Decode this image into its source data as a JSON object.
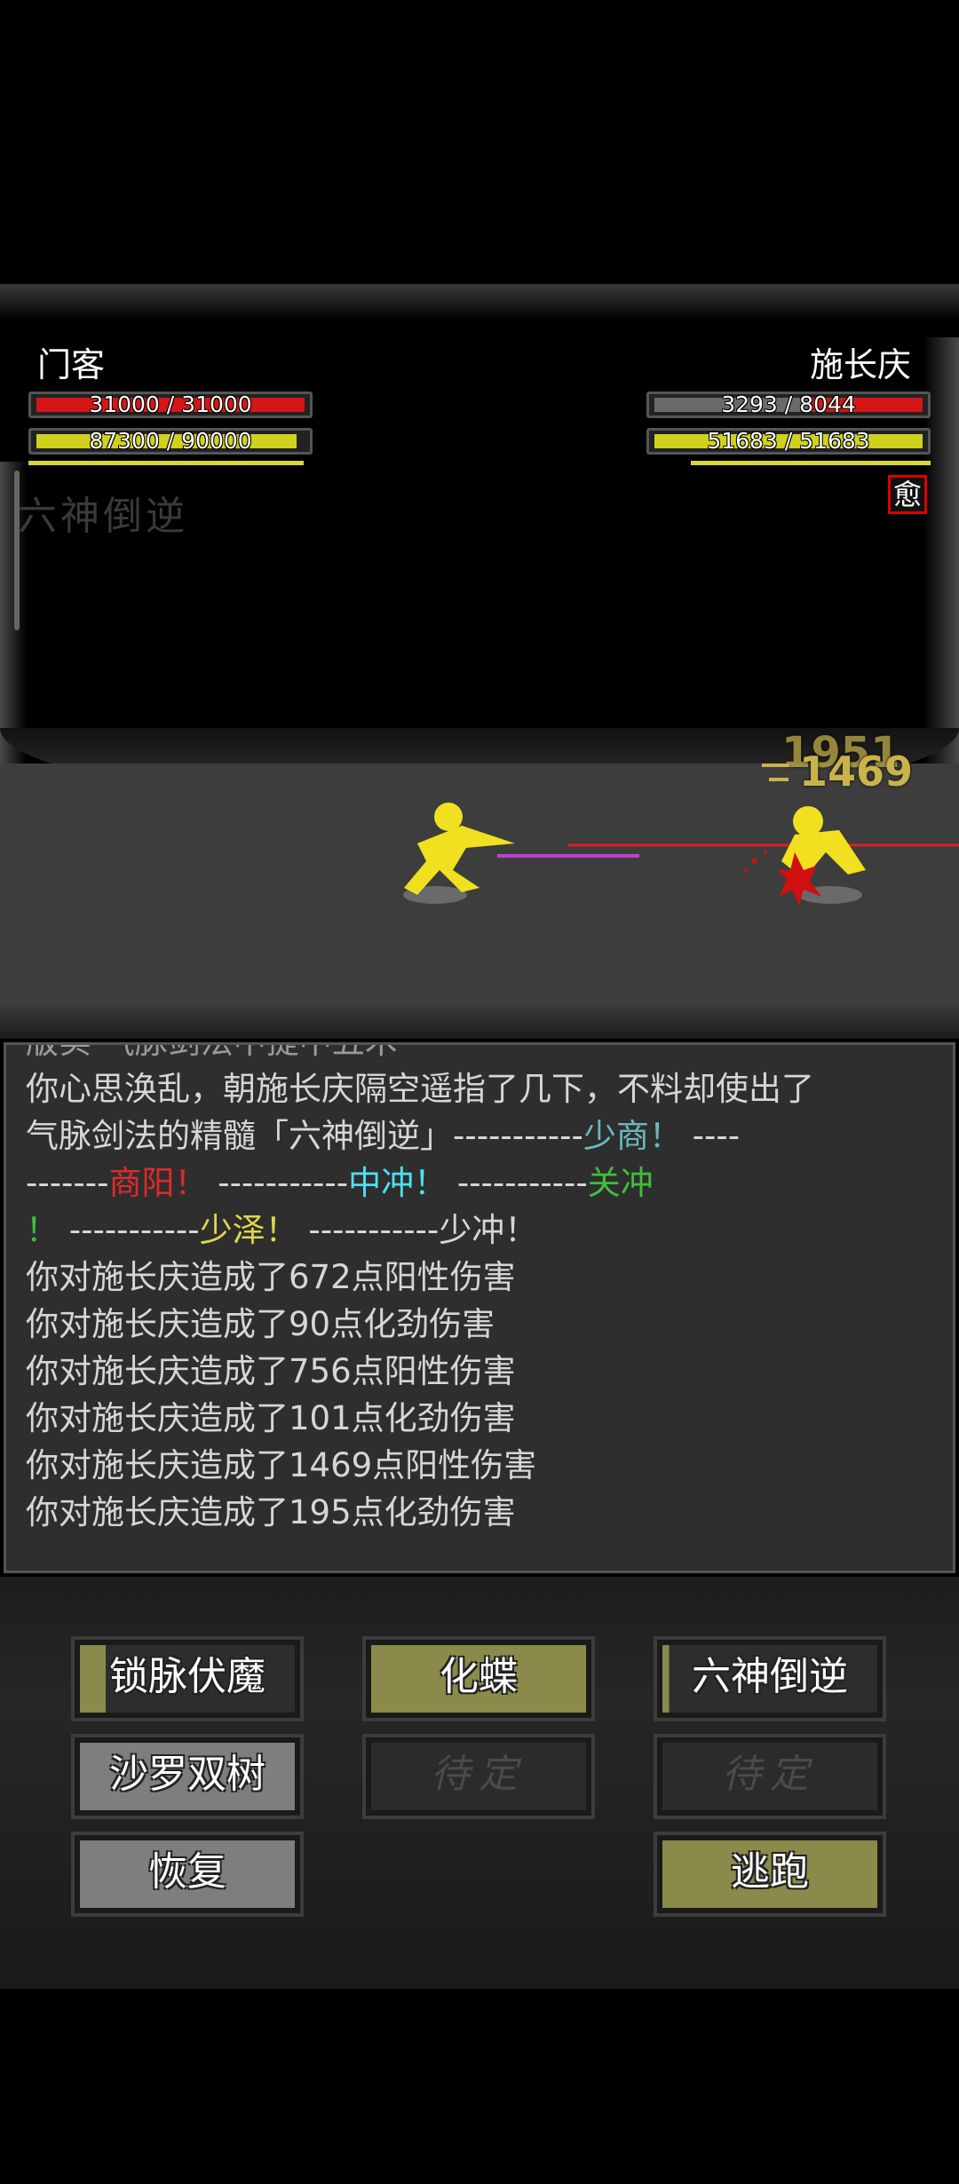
{
  "player": {
    "name": "门客",
    "hp_text": "31000 / 31000",
    "hp_fraction": 1.0,
    "mp_text": "87300 / 90000",
    "mp_fraction": 0.97
  },
  "enemy": {
    "name": "施长庆",
    "hp_text": "3293 / 8044",
    "hp_fraction": 0.41,
    "mp_text": "51683 / 51683",
    "mp_fraction": 1.0,
    "status_badge": "愈"
  },
  "battle": {
    "skill_name_faded": "六神倒逆",
    "damage_numbers": [
      "1951",
      "1469"
    ]
  },
  "log": {
    "cut_line": "版实  气脉剑法中提中五术",
    "line1": "你心思涣乱，朝施长庆隔空遥指了几下，不料却使出了",
    "line2_prefix": "气脉剑法的精髓「六神倒逆」-----------",
    "line2_a": "少商！",
    "line2_dash": " ----",
    "line3_dash1": "-------",
    "line3_b": "商阳！",
    "line3_dash2": " -----------",
    "line3_c": "中冲！",
    "line3_dash3": " -----------",
    "line3_d": "关冲",
    "line4_d_end": "！",
    "line4_dash1": " -----------",
    "line4_e": "少泽！",
    "line4_dash2": " -----------",
    "line4_f": "少冲！",
    "entries": [
      "你对施长庆造成了672点阳性伤害",
      "你对施长庆造成了90点化劲伤害",
      "你对施长庆造成了756点阳性伤害",
      "你对施长庆造成了101点化劲伤害",
      "你对施长庆造成了1469点阳性伤害",
      "你对施长庆造成了195点化劲伤害"
    ]
  },
  "skills": {
    "b1": "锁脉伏魔",
    "b1_cooldown": 0.12,
    "b2": "化蝶",
    "b3": "六神倒逆",
    "b3_cooldown": 0.03,
    "b4": "沙罗双树",
    "b5": "待定",
    "b6": "待定",
    "b7": "恢复",
    "b9": "逃跑"
  },
  "colors": {
    "hp": "#d41616",
    "mp": "#d0d020",
    "olive_button": "#8a8a4a",
    "figure": "#f0e020"
  }
}
